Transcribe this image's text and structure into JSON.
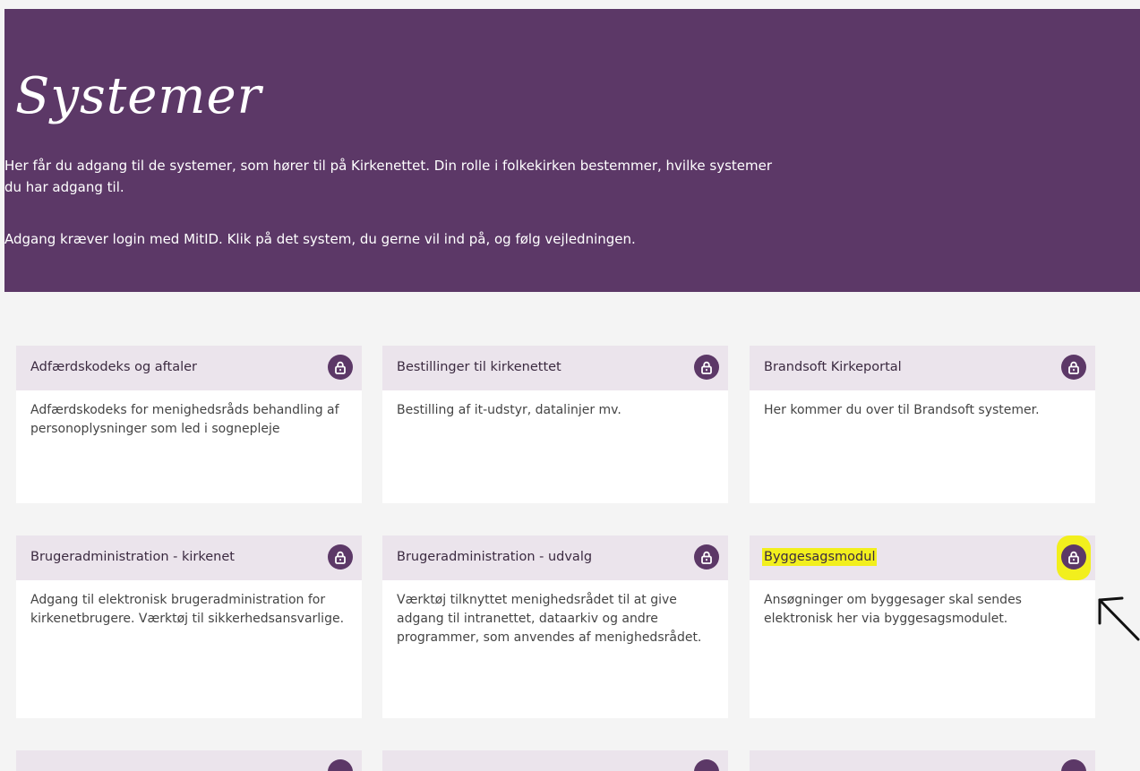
{
  "hero": {
    "title": "Systemer",
    "paragraph1": "Her får du adgang til de systemer, som hører til på Kirkenettet. Din rolle i folkekirken bestemmer, hvilke systemer du har adgang til.",
    "paragraph2": "Adgang kræver login med MitID. Klik på det system, du gerne vil ind på, og følg vejledningen.",
    "background_color": "#5c3867"
  },
  "cards": [
    {
      "title": "Adfærdskodeks og aftaler",
      "description": "Adfærdskodeks for menighedsråds behandling af personoplysninger som led i sognepleje",
      "icon": "lock-icon"
    },
    {
      "title": "Bestillinger til kirkenettet",
      "description": "Bestilling af it-udstyr, datalinjer mv.",
      "icon": "lock-icon"
    },
    {
      "title": "Brandsoft Kirkeportal",
      "description": "Her kommer du over til Brandsoft systemer.",
      "icon": "lock-icon"
    },
    {
      "title": "Brugeradministration - kirkenet",
      "description": "Adgang til elektronisk brugeradministration for kirkenetbrugere. Værktøj til sikkerhedsansvarlige.",
      "icon": "lock-icon"
    },
    {
      "title": "Brugeradministration - udvalg",
      "description": "Værktøj tilknyttet menighedsrådet til at give adgang til intranettet, dataarkiv og andre programmer, som anvendes af menighedsrådet.",
      "icon": "lock-icon"
    },
    {
      "title": "Byggesagsmodul",
      "description": "Ansøgninger om byggesager skal sendes elektronisk her via byggesagsmodulet.",
      "icon": "lock-icon",
      "highlighted": true
    }
  ],
  "colors": {
    "card_header_bg": "#ebe4ec",
    "lock_bg": "#5c3867",
    "highlight": "#f2ef1d"
  }
}
